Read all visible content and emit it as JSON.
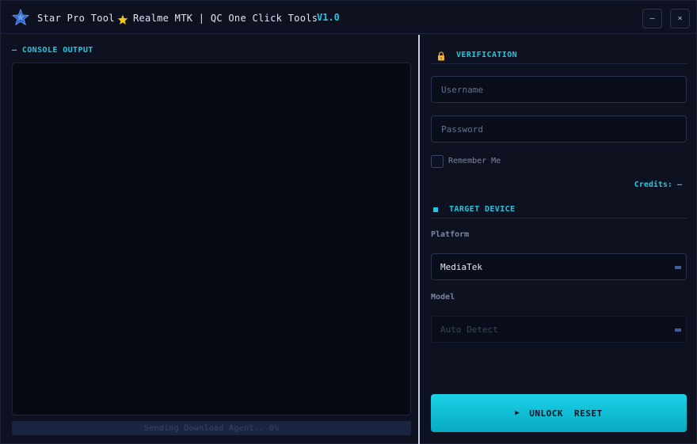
{
  "titlebar": {
    "app_name": "Star Pro Tool",
    "subtitle": "Realme MTK | QC One Click Tools",
    "version": "V1.0",
    "minimize_label": "–",
    "close_label": "×"
  },
  "console": {
    "label": "— CONSOLE OUTPUT",
    "lines": []
  },
  "progress": {
    "text": "Sending Download Agent..  0%",
    "percent": 0
  },
  "verification": {
    "title": "VERIFICATION",
    "username_placeholder": "Username",
    "password_placeholder": "Password",
    "remember_label": "Remember Me",
    "remember_checked": false,
    "credits": "Credits: —"
  },
  "target_device": {
    "title": "TARGET DEVICE",
    "platform_label": "Platform",
    "platform_value": "MediaTek",
    "model_label": "Model",
    "model_value": "Auto Detect"
  },
  "action": {
    "unlock_label": "UNLOCK",
    "reset_label": "RESET"
  },
  "icons": {
    "app": "star-icon",
    "sub": "star-icon",
    "verification": "lock-icon",
    "target": "square-icon",
    "select": "dropdown-icon",
    "action": "play-icon"
  },
  "colors": {
    "accent": "#1ec8e0",
    "background": "#0d1120",
    "console_bg": "#070a13",
    "button_gradient_top": "#1bd2e6",
    "button_gradient_bottom": "#08a9c2"
  }
}
